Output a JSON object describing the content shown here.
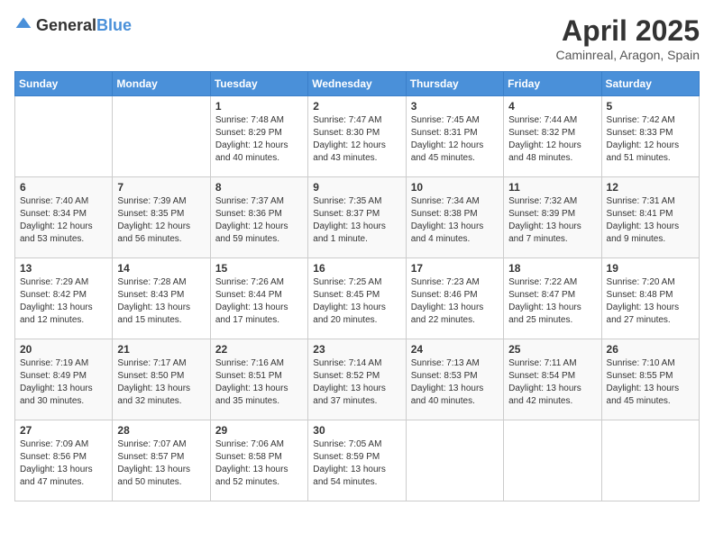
{
  "logo": {
    "general": "General",
    "blue": "Blue"
  },
  "title": {
    "month_year": "April 2025",
    "location": "Caminreal, Aragon, Spain"
  },
  "weekdays": [
    "Sunday",
    "Monday",
    "Tuesday",
    "Wednesday",
    "Thursday",
    "Friday",
    "Saturday"
  ],
  "weeks": [
    [
      {
        "day": "",
        "sunrise": "",
        "sunset": "",
        "daylight": ""
      },
      {
        "day": "",
        "sunrise": "",
        "sunset": "",
        "daylight": ""
      },
      {
        "day": "1",
        "sunrise": "Sunrise: 7:48 AM",
        "sunset": "Sunset: 8:29 PM",
        "daylight": "Daylight: 12 hours and 40 minutes."
      },
      {
        "day": "2",
        "sunrise": "Sunrise: 7:47 AM",
        "sunset": "Sunset: 8:30 PM",
        "daylight": "Daylight: 12 hours and 43 minutes."
      },
      {
        "day": "3",
        "sunrise": "Sunrise: 7:45 AM",
        "sunset": "Sunset: 8:31 PM",
        "daylight": "Daylight: 12 hours and 45 minutes."
      },
      {
        "day": "4",
        "sunrise": "Sunrise: 7:44 AM",
        "sunset": "Sunset: 8:32 PM",
        "daylight": "Daylight: 12 hours and 48 minutes."
      },
      {
        "day": "5",
        "sunrise": "Sunrise: 7:42 AM",
        "sunset": "Sunset: 8:33 PM",
        "daylight": "Daylight: 12 hours and 51 minutes."
      }
    ],
    [
      {
        "day": "6",
        "sunrise": "Sunrise: 7:40 AM",
        "sunset": "Sunset: 8:34 PM",
        "daylight": "Daylight: 12 hours and 53 minutes."
      },
      {
        "day": "7",
        "sunrise": "Sunrise: 7:39 AM",
        "sunset": "Sunset: 8:35 PM",
        "daylight": "Daylight: 12 hours and 56 minutes."
      },
      {
        "day": "8",
        "sunrise": "Sunrise: 7:37 AM",
        "sunset": "Sunset: 8:36 PM",
        "daylight": "Daylight: 12 hours and 59 minutes."
      },
      {
        "day": "9",
        "sunrise": "Sunrise: 7:35 AM",
        "sunset": "Sunset: 8:37 PM",
        "daylight": "Daylight: 13 hours and 1 minute."
      },
      {
        "day": "10",
        "sunrise": "Sunrise: 7:34 AM",
        "sunset": "Sunset: 8:38 PM",
        "daylight": "Daylight: 13 hours and 4 minutes."
      },
      {
        "day": "11",
        "sunrise": "Sunrise: 7:32 AM",
        "sunset": "Sunset: 8:39 PM",
        "daylight": "Daylight: 13 hours and 7 minutes."
      },
      {
        "day": "12",
        "sunrise": "Sunrise: 7:31 AM",
        "sunset": "Sunset: 8:41 PM",
        "daylight": "Daylight: 13 hours and 9 minutes."
      }
    ],
    [
      {
        "day": "13",
        "sunrise": "Sunrise: 7:29 AM",
        "sunset": "Sunset: 8:42 PM",
        "daylight": "Daylight: 13 hours and 12 minutes."
      },
      {
        "day": "14",
        "sunrise": "Sunrise: 7:28 AM",
        "sunset": "Sunset: 8:43 PM",
        "daylight": "Daylight: 13 hours and 15 minutes."
      },
      {
        "day": "15",
        "sunrise": "Sunrise: 7:26 AM",
        "sunset": "Sunset: 8:44 PM",
        "daylight": "Daylight: 13 hours and 17 minutes."
      },
      {
        "day": "16",
        "sunrise": "Sunrise: 7:25 AM",
        "sunset": "Sunset: 8:45 PM",
        "daylight": "Daylight: 13 hours and 20 minutes."
      },
      {
        "day": "17",
        "sunrise": "Sunrise: 7:23 AM",
        "sunset": "Sunset: 8:46 PM",
        "daylight": "Daylight: 13 hours and 22 minutes."
      },
      {
        "day": "18",
        "sunrise": "Sunrise: 7:22 AM",
        "sunset": "Sunset: 8:47 PM",
        "daylight": "Daylight: 13 hours and 25 minutes."
      },
      {
        "day": "19",
        "sunrise": "Sunrise: 7:20 AM",
        "sunset": "Sunset: 8:48 PM",
        "daylight": "Daylight: 13 hours and 27 minutes."
      }
    ],
    [
      {
        "day": "20",
        "sunrise": "Sunrise: 7:19 AM",
        "sunset": "Sunset: 8:49 PM",
        "daylight": "Daylight: 13 hours and 30 minutes."
      },
      {
        "day": "21",
        "sunrise": "Sunrise: 7:17 AM",
        "sunset": "Sunset: 8:50 PM",
        "daylight": "Daylight: 13 hours and 32 minutes."
      },
      {
        "day": "22",
        "sunrise": "Sunrise: 7:16 AM",
        "sunset": "Sunset: 8:51 PM",
        "daylight": "Daylight: 13 hours and 35 minutes."
      },
      {
        "day": "23",
        "sunrise": "Sunrise: 7:14 AM",
        "sunset": "Sunset: 8:52 PM",
        "daylight": "Daylight: 13 hours and 37 minutes."
      },
      {
        "day": "24",
        "sunrise": "Sunrise: 7:13 AM",
        "sunset": "Sunset: 8:53 PM",
        "daylight": "Daylight: 13 hours and 40 minutes."
      },
      {
        "day": "25",
        "sunrise": "Sunrise: 7:11 AM",
        "sunset": "Sunset: 8:54 PM",
        "daylight": "Daylight: 13 hours and 42 minutes."
      },
      {
        "day": "26",
        "sunrise": "Sunrise: 7:10 AM",
        "sunset": "Sunset: 8:55 PM",
        "daylight": "Daylight: 13 hours and 45 minutes."
      }
    ],
    [
      {
        "day": "27",
        "sunrise": "Sunrise: 7:09 AM",
        "sunset": "Sunset: 8:56 PM",
        "daylight": "Daylight: 13 hours and 47 minutes."
      },
      {
        "day": "28",
        "sunrise": "Sunrise: 7:07 AM",
        "sunset": "Sunset: 8:57 PM",
        "daylight": "Daylight: 13 hours and 50 minutes."
      },
      {
        "day": "29",
        "sunrise": "Sunrise: 7:06 AM",
        "sunset": "Sunset: 8:58 PM",
        "daylight": "Daylight: 13 hours and 52 minutes."
      },
      {
        "day": "30",
        "sunrise": "Sunrise: 7:05 AM",
        "sunset": "Sunset: 8:59 PM",
        "daylight": "Daylight: 13 hours and 54 minutes."
      },
      {
        "day": "",
        "sunrise": "",
        "sunset": "",
        "daylight": ""
      },
      {
        "day": "",
        "sunrise": "",
        "sunset": "",
        "daylight": ""
      },
      {
        "day": "",
        "sunrise": "",
        "sunset": "",
        "daylight": ""
      }
    ]
  ]
}
